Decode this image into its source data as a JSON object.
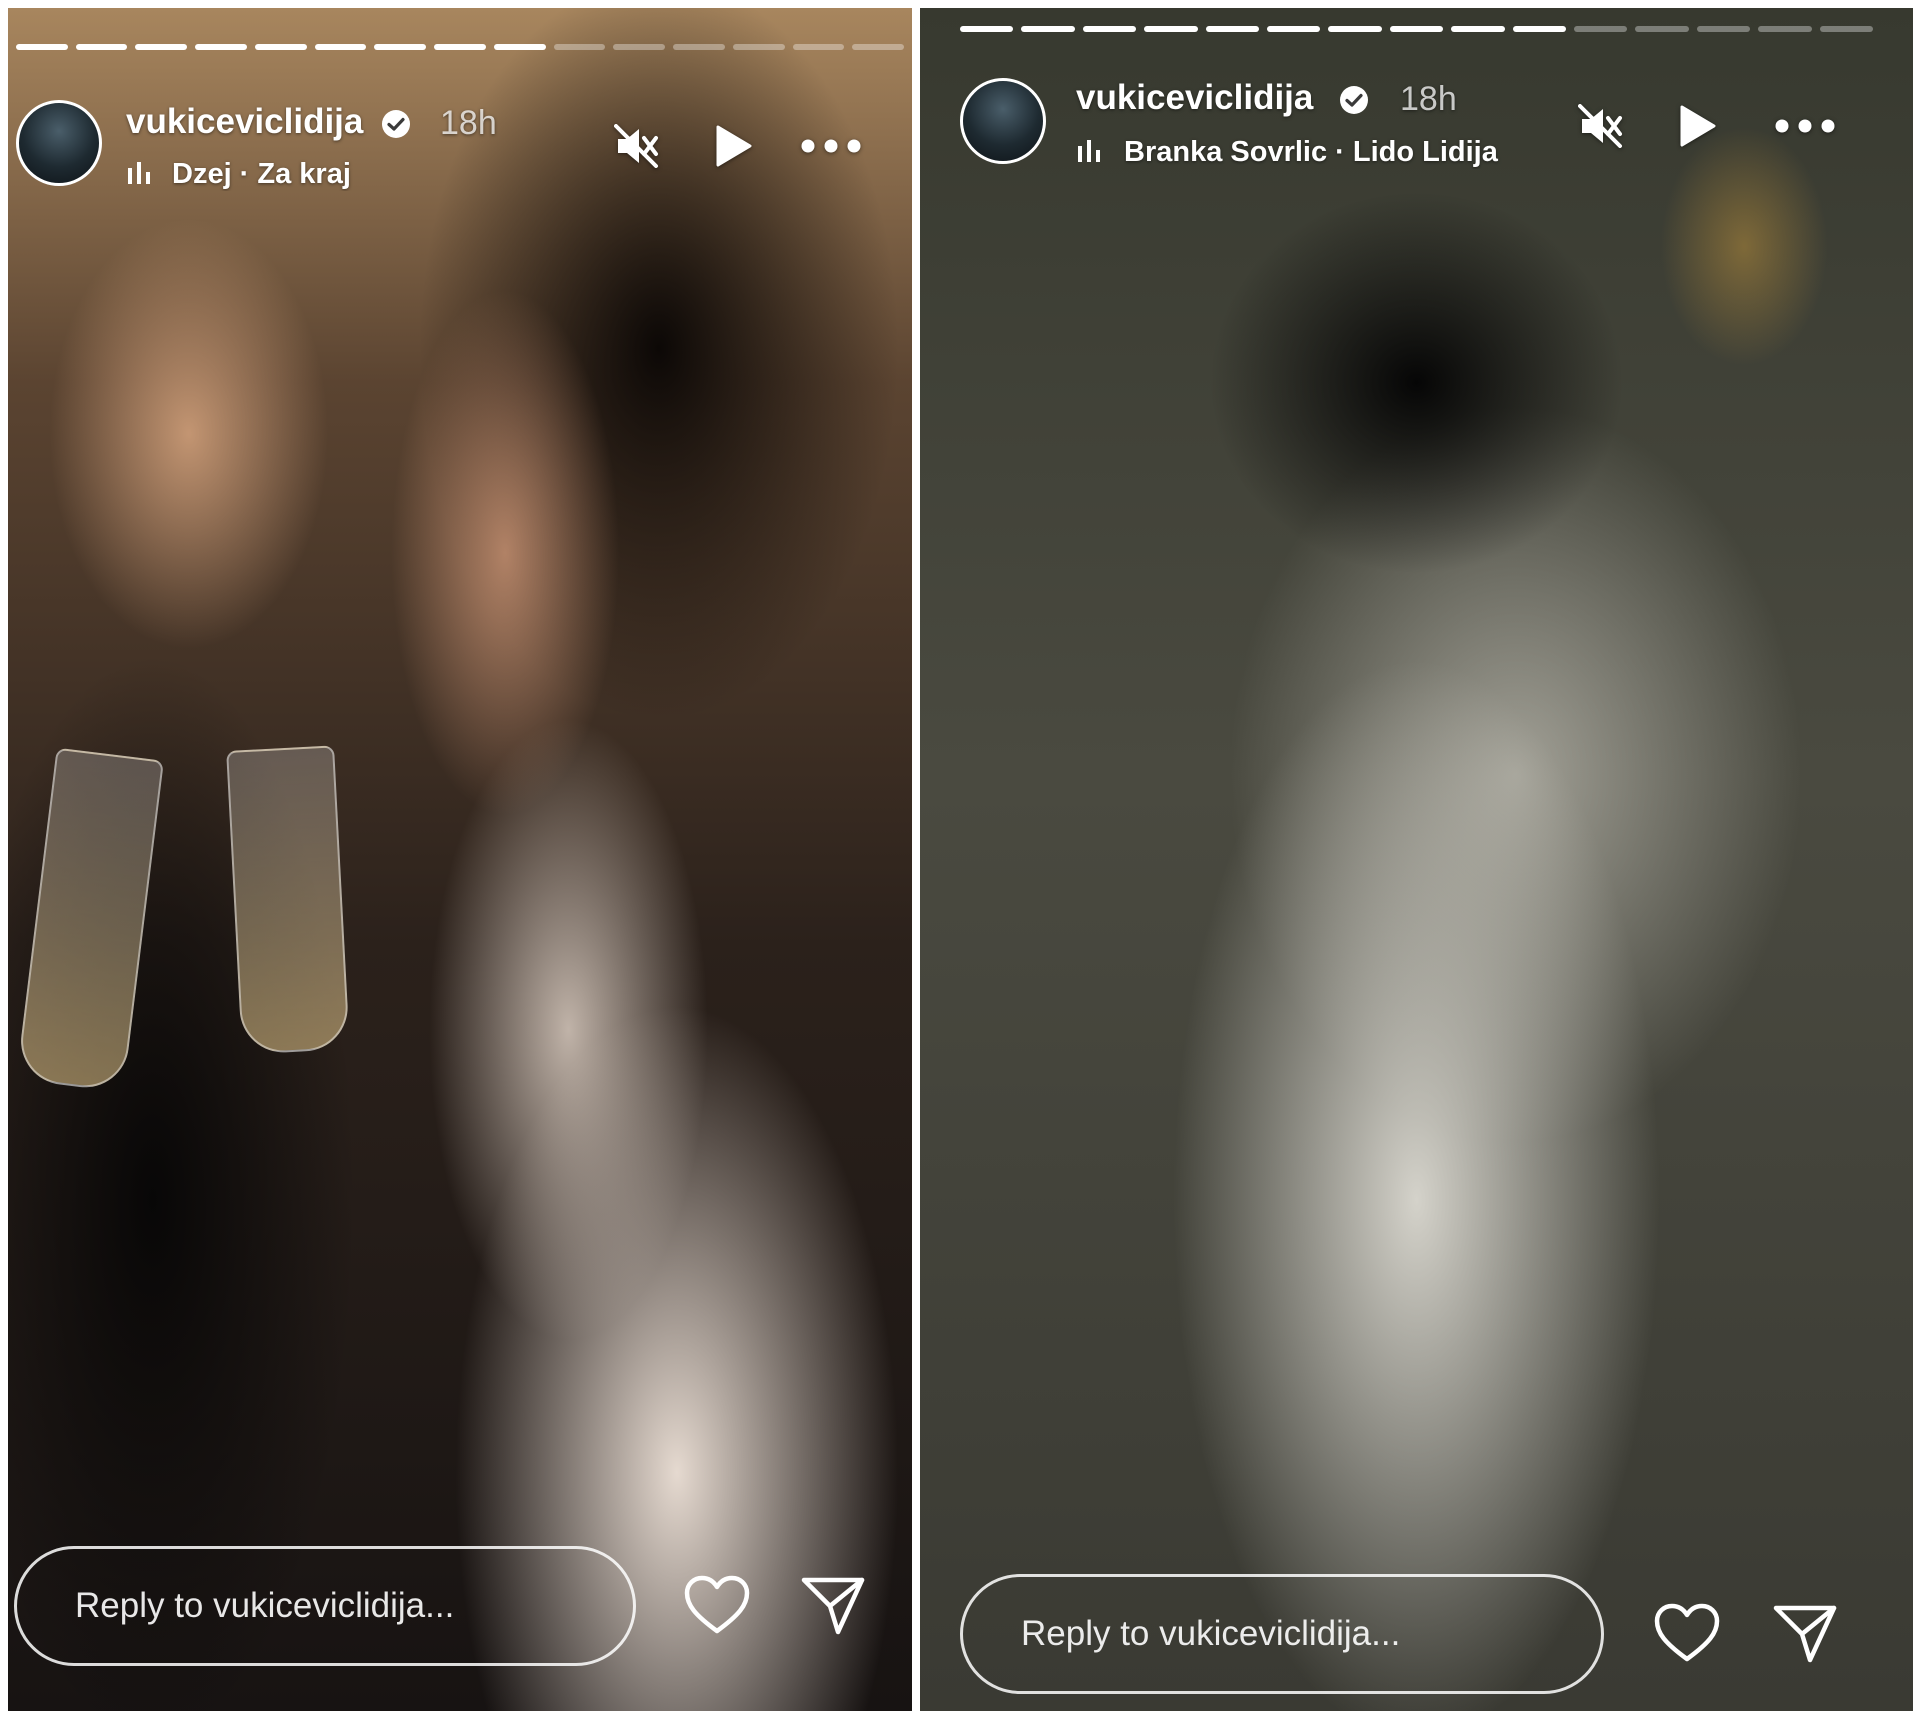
{
  "stories": [
    {
      "username": "vukiceviclidija",
      "time": "18h",
      "music": "Dzej · Za kraj",
      "reply_placeholder": "Reply to vukiceviclidija...",
      "progress_segments_total": 15,
      "progress_segments_done": 9
    },
    {
      "username": "vukiceviclidija",
      "time": "18h",
      "music": "Branka Sovrlic · Lido Lidija",
      "reply_placeholder": "Reply to vukiceviclidija...",
      "progress_segments_total": 15,
      "progress_segments_done": 10
    }
  ],
  "icons": {
    "verified": "verified-badge-icon",
    "music": "music-bars-icon",
    "mute": "speaker-muted-icon",
    "play": "play-icon",
    "more": "more-dots-icon",
    "like": "heart-icon",
    "share": "send-icon"
  },
  "colors": {
    "text": "#ffffff",
    "progress_done": "#ffffff",
    "progress_pending": "rgba(255,255,255,0.35)"
  }
}
